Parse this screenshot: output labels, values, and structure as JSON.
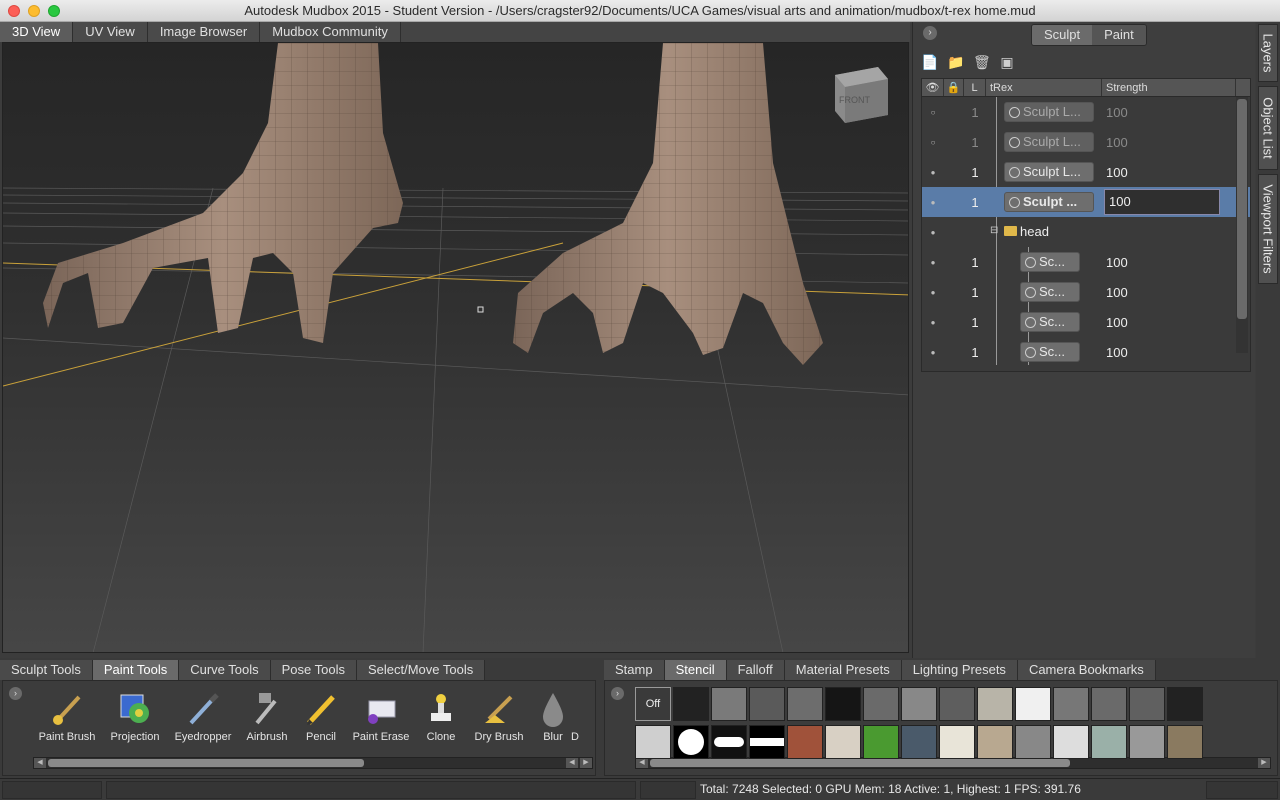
{
  "window": {
    "title": "Autodesk Mudbox 2015 - Student Version - /Users/cragster92/Documents/UCA Games/visual arts and animation/mudbox/t-rex home.mud"
  },
  "view_tabs": [
    "3D View",
    "UV View",
    "Image Browser",
    "Mudbox Community"
  ],
  "viewport": {
    "viewcube_label": "FRONT"
  },
  "mode_switch": {
    "sculpt": "Sculpt",
    "paint": "Paint"
  },
  "layers": {
    "columns": {
      "visible": "",
      "lock": "",
      "level": "L",
      "name": "tRex",
      "strength": "Strength"
    },
    "rows": [
      {
        "level": "1",
        "name": "Sculpt L...",
        "strength": "100",
        "faded": true
      },
      {
        "level": "1",
        "name": "Sculpt L...",
        "strength": "100",
        "faded": true
      },
      {
        "level": "1",
        "name": "Sculpt L...",
        "strength": "100",
        "faded": false
      },
      {
        "level": "1",
        "name": "Sculpt ...",
        "strength": "100",
        "faded": false,
        "selected": true
      }
    ],
    "folder": {
      "name": "head"
    },
    "child_rows": [
      {
        "level": "1",
        "name": "Sc...",
        "strength": "100"
      },
      {
        "level": "1",
        "name": "Sc...",
        "strength": "100"
      },
      {
        "level": "1",
        "name": "Sc...",
        "strength": "100"
      },
      {
        "level": "1",
        "name": "Sc...",
        "strength": "100"
      }
    ]
  },
  "side_tabs": [
    "Layers",
    "Object List",
    "Viewport Filters"
  ],
  "tool_tray": {
    "tabs": [
      "Sculpt Tools",
      "Paint Tools",
      "Curve Tools",
      "Pose Tools",
      "Select/Move Tools"
    ],
    "active_tab": "Paint Tools",
    "tools": [
      "Paint Brush",
      "Projection",
      "Eyedropper",
      "Airbrush",
      "Pencil",
      "Paint Erase",
      "Clone",
      "Dry Brush",
      "Blur",
      "D"
    ]
  },
  "stamp_tray": {
    "tabs": [
      "Stamp",
      "Stencil",
      "Falloff",
      "Material Presets",
      "Lighting Presets",
      "Camera Bookmarks"
    ],
    "active_tab": "Stencil",
    "off_label": "Off"
  },
  "status": {
    "text": "Total: 7248  Selected: 0 GPU Mem: 18  Active: 1, Highest: 1  FPS: 391.76"
  },
  "colors": {
    "selection": "#5a7ca8",
    "folder": "#e0b84a",
    "accent_line": "#c9a13a"
  }
}
